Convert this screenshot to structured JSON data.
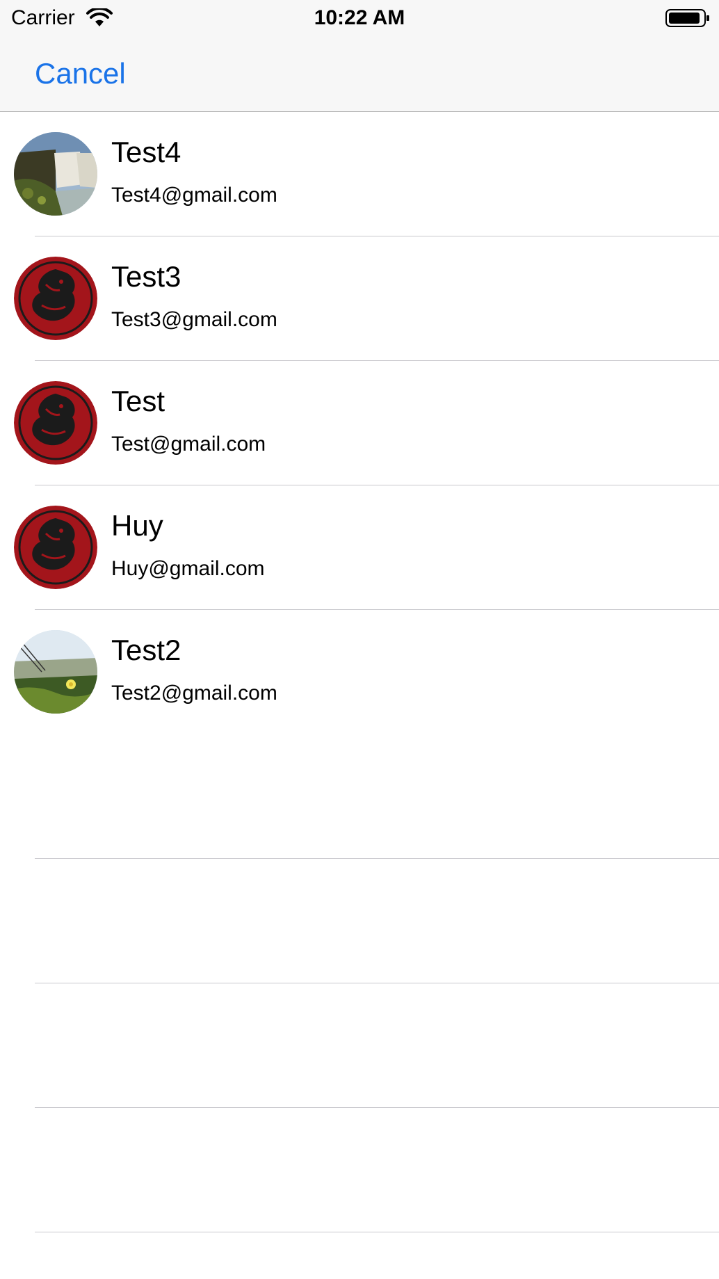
{
  "status_bar": {
    "carrier": "Carrier",
    "time": "10:22 AM",
    "wifi_icon": "wifi-icon",
    "battery_icon": "battery-icon"
  },
  "nav": {
    "cancel_label": "Cancel",
    "accent_color": "#1a73e8"
  },
  "contacts": [
    {
      "name": "Test4",
      "email": "Test4@gmail.com",
      "avatar": "waterfall-photo"
    },
    {
      "name": "Test3",
      "email": "Test3@gmail.com",
      "avatar": "dragon-sigil"
    },
    {
      "name": "Test",
      "email": "Test@gmail.com",
      "avatar": "dragon-sigil"
    },
    {
      "name": "Huy",
      "email": "Huy@gmail.com",
      "avatar": "dragon-sigil"
    },
    {
      "name": "Test2",
      "email": "Test2@gmail.com",
      "avatar": "flower-field-photo"
    }
  ]
}
